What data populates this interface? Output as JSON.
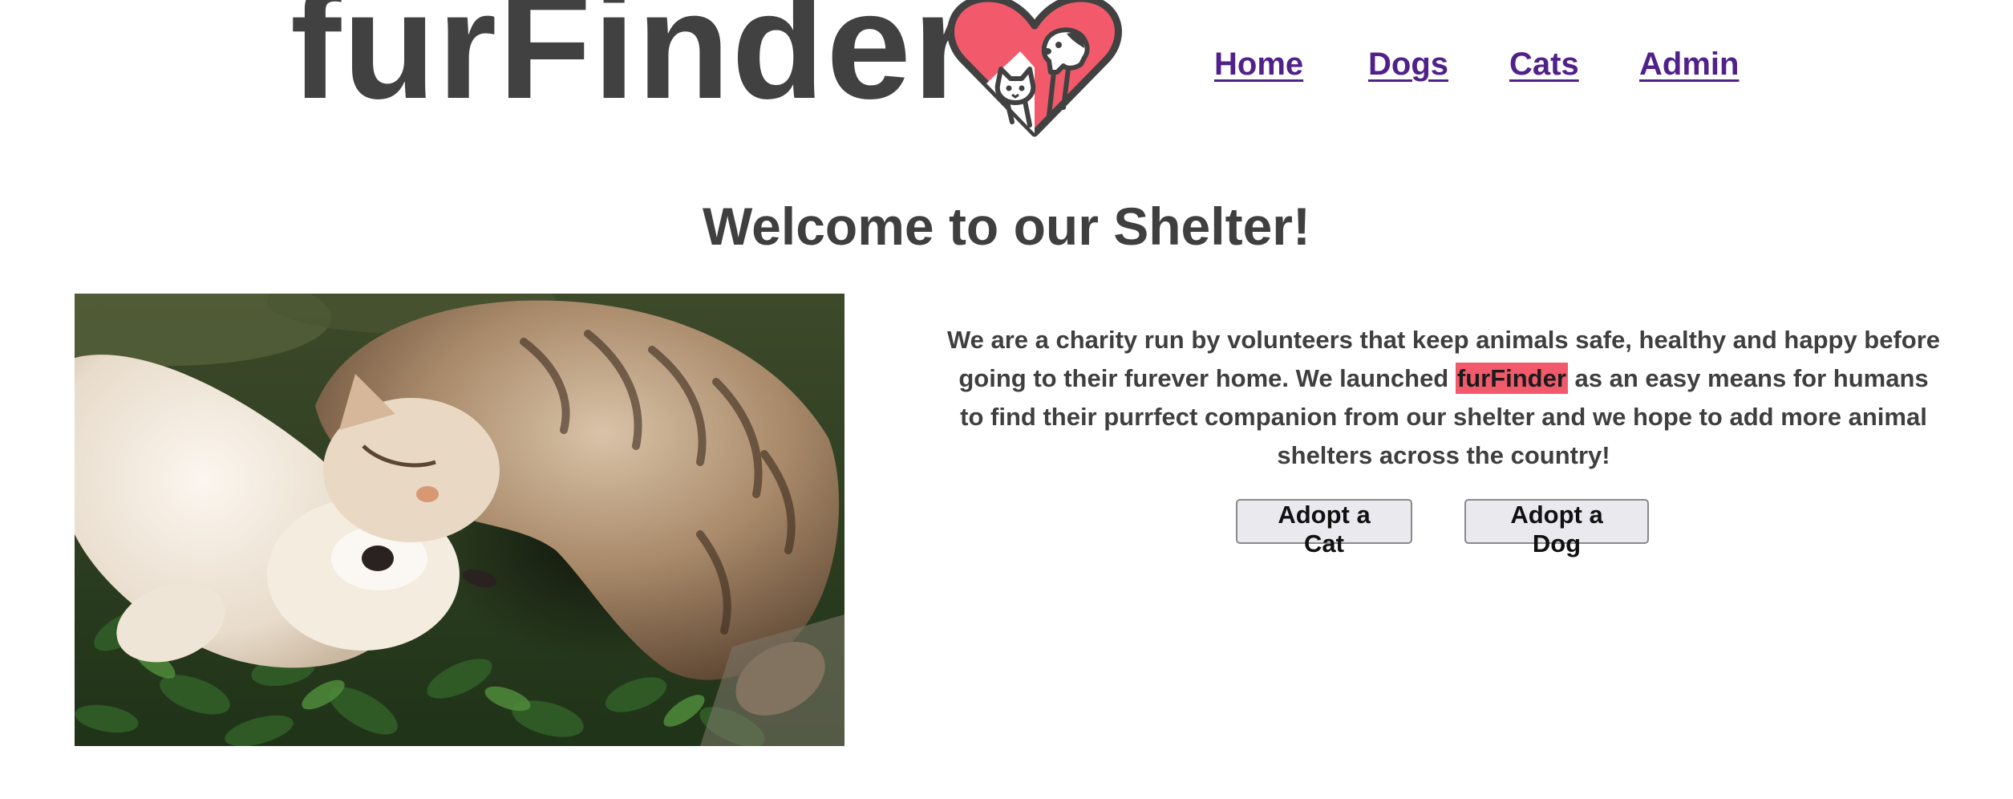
{
  "brand": {
    "name": "furFinder",
    "heart_color": "#f25a6b",
    "logo_text_color": "#414141",
    "icon": "heart-cat-dog-logo-icon"
  },
  "nav": {
    "items": [
      {
        "label": "Home"
      },
      {
        "label": "Dogs"
      },
      {
        "label": "Cats"
      },
      {
        "label": "Admin"
      }
    ],
    "link_color": "#51218a"
  },
  "main": {
    "title": "Welcome to our Shelter!",
    "photo": {
      "description_icon": "cat-and-dog-photo"
    },
    "intro": {
      "before": "We are a charity run by volunteers that keep animals safe, healthy and happy before going to their furever home. We launched ",
      "highlight": "furFinder",
      "after": " as an easy means for humans to find their purrfect companion from our shelter and we hope to add more animal shelters across the country!"
    },
    "actions": {
      "adopt_cat": "Adopt a Cat",
      "adopt_dog": "Adopt a Dog"
    }
  }
}
